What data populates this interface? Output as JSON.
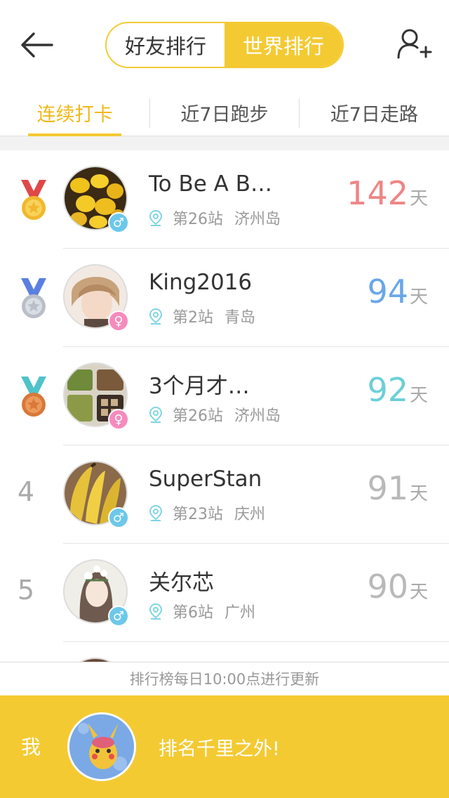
{
  "header": {
    "segments": [
      {
        "label": "好友排行",
        "active": false
      },
      {
        "label": "世界排行",
        "active": true
      }
    ],
    "back_icon": "arrow-left-icon",
    "add_icon": "add-user-icon"
  },
  "tabs": [
    {
      "label": "连续打卡",
      "active": true
    },
    {
      "label": "近7日跑步",
      "active": false
    },
    {
      "label": "近7日走路",
      "active": false
    }
  ],
  "ranking": [
    {
      "rank": "1",
      "medal": "gold",
      "name": "To Be A B…",
      "gender": "male",
      "gender_symbol": "♂",
      "station": "第26站",
      "city": "济州岛",
      "value": "142",
      "unit": "天",
      "value_color": "#ef8585"
    },
    {
      "rank": "2",
      "medal": "silver",
      "name": "King2016",
      "gender": "female",
      "gender_symbol": "♀",
      "station": "第2站",
      "city": "青岛",
      "value": "94",
      "unit": "天",
      "value_color": "#6aa7e8"
    },
    {
      "rank": "3",
      "medal": "bronze",
      "name": "3个月才…",
      "gender": "female",
      "gender_symbol": "♀",
      "station": "第26站",
      "city": "济州岛",
      "value": "92",
      "unit": "天",
      "value_color": "#6ccfd8"
    },
    {
      "rank": "4",
      "medal": "",
      "name": "SuperStan",
      "gender": "male",
      "gender_symbol": "♂",
      "station": "第23站",
      "city": "庆州",
      "value": "91",
      "unit": "天",
      "value_color": "#b9b9b9"
    },
    {
      "rank": "5",
      "medal": "",
      "name": "关尔芯",
      "gender": "male",
      "gender_symbol": "♂",
      "station": "第6站",
      "city": "广州",
      "value": "90",
      "unit": "天",
      "value_color": "#b9b9b9"
    }
  ],
  "footer_note": "排行榜每日10:00点进行更新",
  "me": {
    "label": "我",
    "status": "排名千里之外!"
  },
  "colors": {
    "accent": "#f4ca33",
    "gold": "#f1b82d",
    "silver": "#c8ccd4",
    "bronze": "#e0894a"
  }
}
